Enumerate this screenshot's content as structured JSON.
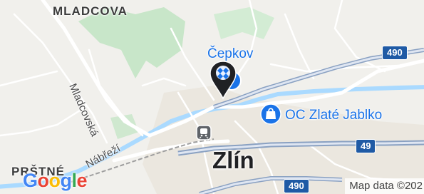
{
  "map": {
    "labels": {
      "district_north": "MLADCOVA",
      "district_southwest": "PRŠTNÉ",
      "street_mladcovska": "Mladcovská",
      "street_nabrezi": "Nábřeží",
      "city": "Zlín"
    },
    "places": {
      "cepkov": "Čepkov",
      "mall": "OC Zlaté Jablko"
    },
    "road_shields": {
      "r490_upper": "490",
      "r49": "49",
      "r490_lower": "490"
    },
    "logo_letters": [
      "G",
      "o",
      "o",
      "g",
      "l",
      "e"
    ],
    "attribution": "Map data ©202",
    "colors": {
      "water": "#aadaff",
      "park": "#c4e5c3",
      "road": "#ffffff",
      "major_road": "#8aa1c2",
      "poi_blue": "#1a73e8",
      "highway_shield": "#1f5aa5"
    }
  }
}
